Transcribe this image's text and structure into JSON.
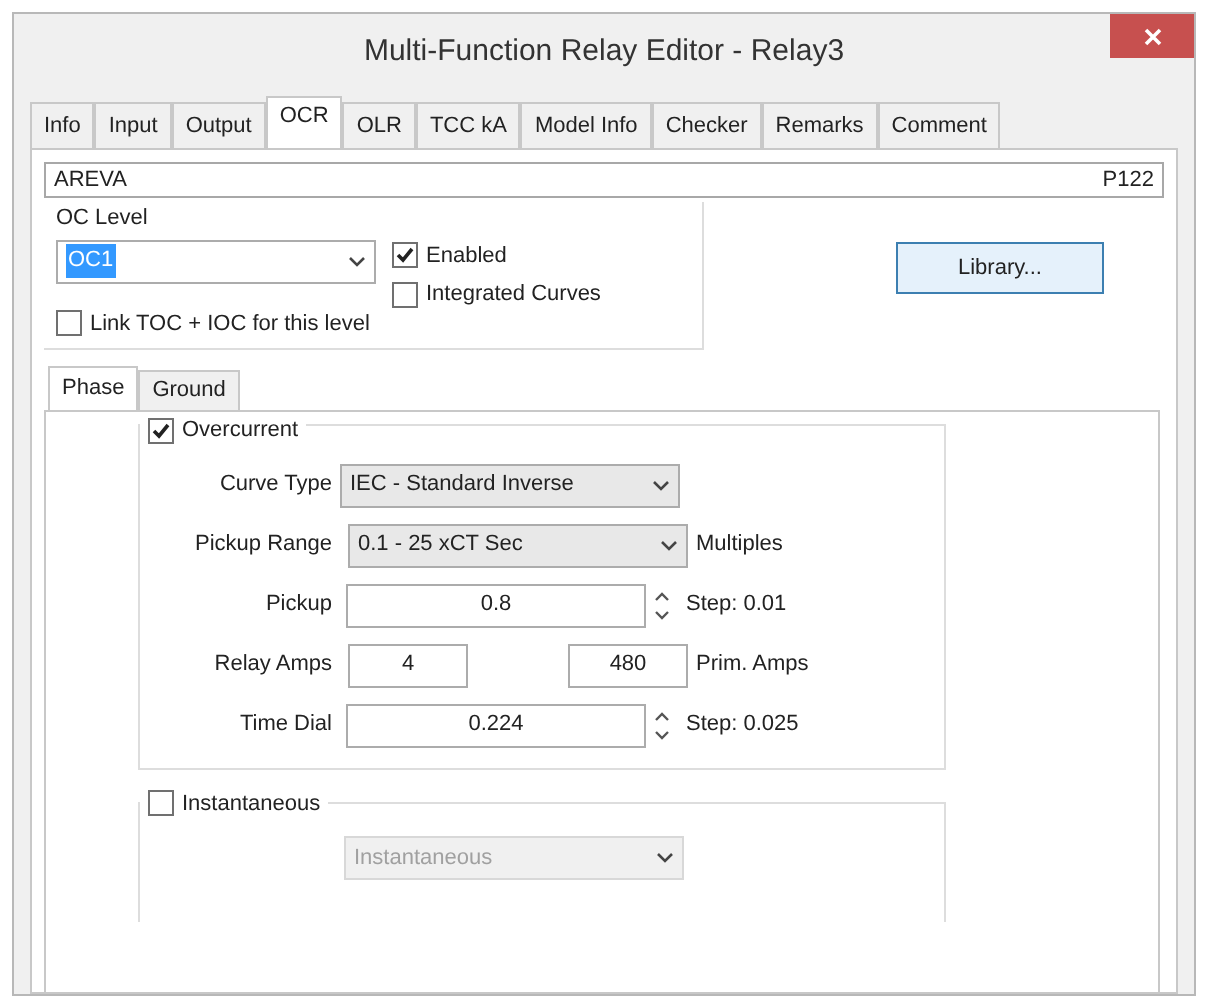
{
  "window": {
    "title": "Multi-Function Relay Editor - Relay3"
  },
  "tabs": [
    {
      "label": "Info",
      "selected": false
    },
    {
      "label": "Input",
      "selected": false
    },
    {
      "label": "Output",
      "selected": false
    },
    {
      "label": "OCR",
      "selected": true
    },
    {
      "label": "OLR",
      "selected": false
    },
    {
      "label": "TCC kA",
      "selected": false
    },
    {
      "label": "Model Info",
      "selected": false
    },
    {
      "label": "Checker",
      "selected": false
    },
    {
      "label": "Remarks",
      "selected": false
    },
    {
      "label": "Comment",
      "selected": false
    }
  ],
  "header": {
    "manufacturer": "AREVA",
    "model": "P122"
  },
  "oc_level": {
    "title": "OC Level",
    "value": "OC1",
    "enabled": {
      "label": "Enabled",
      "checked": true
    },
    "integrated_curves": {
      "label": "Integrated Curves",
      "checked": false
    },
    "link": {
      "label": "Link TOC + IOC for this level",
      "checked": false
    }
  },
  "library_button": "Library...",
  "sub_tabs": [
    {
      "label": "Phase",
      "selected": true
    },
    {
      "label": "Ground",
      "selected": false
    }
  ],
  "overcurrent": {
    "label": "Overcurrent",
    "checked": true,
    "curve_type": {
      "label": "Curve Type",
      "value": "IEC - Standard Inverse"
    },
    "pickup_range": {
      "label": "Pickup Range",
      "value": "0.1 - 25 xCT Sec",
      "unit": "Multiples"
    },
    "pickup": {
      "label": "Pickup",
      "value": "0.8",
      "step": "Step: 0.01"
    },
    "relay_amps": {
      "label": "Relay Amps",
      "value": "4",
      "prim_value": "480",
      "prim_label": "Prim. Amps"
    },
    "time_dial": {
      "label": "Time Dial",
      "value": "0.224",
      "step": "Step: 0.025"
    }
  },
  "instantaneous": {
    "label": "Instantaneous",
    "checked": false,
    "curve": {
      "value": "Instantaneous",
      "disabled": true
    }
  }
}
